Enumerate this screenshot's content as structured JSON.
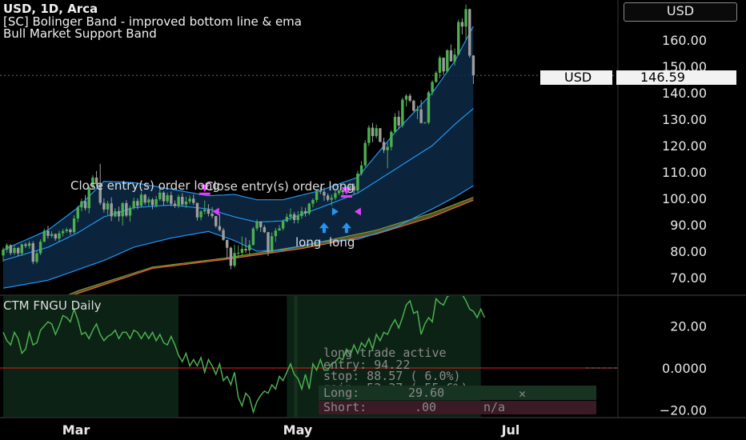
{
  "header": {
    "symbol_line": "USD, 1D, Arca",
    "indicator_line1": "[SC] Bolinger Band - improved bottom line & ema",
    "indicator_line2": "Bull Market Support Band"
  },
  "currency_button": "USD",
  "price_tag": {
    "label": "USD",
    "value": "146.59"
  },
  "lower_pane": {
    "title": "CTM FNGU Daily",
    "info_lines": [
      "long trade active",
      "entry:  94.22",
      "stop:  88.57 ( 6.0%)",
      "gain:  52.37 ( 55.6%)"
    ],
    "long_row": {
      "label": "Long:",
      "value": "29.60",
      "mark": "✕"
    },
    "short_row": {
      "label": "Short:",
      "value": ".00",
      "mark": "n/a"
    }
  },
  "annotations": {
    "close_entry_1": "Close entry(s) order long",
    "close_entry_2": "Close entry(s) order long",
    "long_1": "long",
    "long_2": "long"
  },
  "colors": {
    "up": "#4caf50",
    "down": "#9e9e9e",
    "band_line": "#2196f3",
    "band_fill": "#0d2a45",
    "ema_fill": "#5d6b2c",
    "ema_line": "#e8623a",
    "osc_line": "#4caf50",
    "zero_line": "#b71c1c",
    "sell_marker": "#e040fb",
    "buy_marker": "#2196f3"
  },
  "chart_data": [
    {
      "type": "candlestick",
      "title": "USD, 1D, Arca",
      "x_ticks": [
        "Mar",
        "May",
        "Jul"
      ],
      "y_ticks": [
        70,
        80,
        90,
        100,
        110,
        120,
        130,
        140,
        150,
        160
      ],
      "ylim": [
        63,
        175
      ],
      "last_price": 146.59,
      "candles": [
        [
          78.4,
          81.4,
          76.0,
          80.6
        ],
        [
          80.6,
          83.0,
          79.5,
          82.3
        ],
        [
          82.3,
          82.6,
          78.5,
          79.3
        ],
        [
          79.3,
          82.6,
          78.6,
          81.2
        ],
        [
          81.2,
          81.6,
          78.0,
          79.2
        ],
        [
          79.2,
          82.9,
          78.2,
          82.6
        ],
        [
          82.6,
          83.3,
          81.2,
          82.0
        ],
        [
          82.0,
          83.9,
          80.9,
          83.0
        ],
        [
          83.0,
          83.8,
          75.1,
          76.0
        ],
        [
          76.0,
          80.1,
          75.3,
          79.2
        ],
        [
          79.2,
          84.5,
          78.5,
          83.6
        ],
        [
          83.6,
          88.6,
          83.4,
          87.7
        ],
        [
          87.7,
          89.6,
          84.8,
          85.8
        ],
        [
          85.8,
          87.6,
          85.1,
          86.5
        ],
        [
          86.5,
          86.7,
          84.0,
          84.8
        ],
        [
          84.8,
          87.8,
          83.7,
          86.8
        ],
        [
          86.8,
          88.5,
          85.6,
          87.6
        ],
        [
          87.6,
          88.9,
          86.9,
          88.2
        ],
        [
          88.2,
          88.7,
          86.1,
          87.2
        ],
        [
          87.2,
          93.6,
          86.6,
          92.4
        ],
        [
          92.4,
          97.2,
          91.0,
          96.6
        ],
        [
          96.6,
          99.9,
          95.1,
          98.9
        ],
        [
          98.9,
          101.3,
          95.4,
          96.3
        ],
        [
          96.3,
          104.9,
          94.3,
          104.2
        ],
        [
          104.2,
          108.8,
          103.8,
          107.9
        ],
        [
          107.9,
          110.4,
          104.9,
          105.4
        ],
        [
          105.4,
          113.1,
          97.5,
          98.3
        ],
        [
          98.3,
          100.0,
          94.6,
          95.8
        ],
        [
          95.8,
          99.1,
          93.8,
          98.1
        ],
        [
          98.1,
          100.4,
          91.4,
          93.2
        ],
        [
          93.2,
          96.3,
          92.8,
          95.2
        ],
        [
          95.2,
          96.9,
          91.3,
          93.2
        ],
        [
          93.2,
          98.6,
          89.7,
          98.2
        ],
        [
          98.2,
          99.3,
          92.9,
          93.5
        ],
        [
          93.5,
          97.2,
          91.2,
          96.4
        ],
        [
          96.4,
          100.3,
          95.7,
          99.0
        ],
        [
          99.0,
          100.0,
          95.9,
          97.2
        ],
        [
          97.2,
          102.3,
          96.6,
          101.4
        ],
        [
          101.4,
          101.7,
          97.5,
          98.4
        ],
        [
          98.4,
          100.6,
          97.0,
          99.6
        ],
        [
          99.6,
          100.2,
          95.9,
          97.4
        ],
        [
          97.4,
          100.9,
          96.6,
          99.7
        ],
        [
          99.7,
          104.1,
          99.0,
          102.2
        ],
        [
          102.2,
          102.7,
          97.2,
          98.9
        ],
        [
          98.9,
          102.2,
          98.1,
          101.2
        ],
        [
          101.2,
          102.6,
          97.0,
          98.0
        ],
        [
          98.0,
          99.2,
          96.4,
          97.2
        ],
        [
          97.2,
          101.5,
          96.3,
          100.6
        ],
        [
          100.6,
          102.0,
          96.9,
          97.7
        ],
        [
          97.7,
          100.7,
          96.4,
          98.8
        ],
        [
          98.8,
          101.1,
          97.9,
          99.9
        ],
        [
          99.9,
          101.5,
          97.5,
          98.3
        ],
        [
          98.3,
          98.3,
          91.6,
          92.8
        ],
        [
          92.8,
          95.6,
          91.7,
          95.1
        ],
        [
          95.1,
          99.2,
          94.0,
          95.8
        ],
        [
          95.8,
          97.8,
          93.2,
          94.2
        ],
        [
          94.2,
          96.7,
          92.5,
          93.3
        ],
        [
          93.3,
          93.3,
          88.9,
          89.5
        ],
        [
          89.5,
          94.1,
          87.5,
          88.0
        ],
        [
          88.0,
          88.8,
          84.0,
          84.3
        ],
        [
          84.3,
          84.3,
          77.0,
          81.3
        ],
        [
          81.3,
          81.7,
          73.2,
          74.5
        ],
        [
          74.5,
          82.4,
          73.8,
          79.3
        ],
        [
          79.3,
          82.2,
          77.6,
          79.4
        ],
        [
          79.4,
          85.6,
          78.4,
          80.9
        ],
        [
          80.9,
          85.2,
          79.3,
          80.3
        ],
        [
          80.3,
          84.2,
          78.2,
          82.4
        ],
        [
          82.4,
          89.2,
          82.1,
          88.6
        ],
        [
          88.6,
          92.0,
          87.7,
          91.3
        ],
        [
          91.3,
          91.3,
          87.3,
          89.1
        ],
        [
          89.1,
          89.9,
          86.9,
          87.2
        ],
        [
          87.2,
          87.2,
          78.2,
          79.6
        ],
        [
          79.6,
          87.1,
          79.5,
          85.7
        ],
        [
          85.7,
          88.8,
          83.5,
          87.8
        ],
        [
          87.8,
          89.9,
          88.1,
          88.6
        ],
        [
          88.6,
          92.1,
          87.8,
          91.3
        ],
        [
          91.3,
          94.2,
          90.9,
          93.0
        ],
        [
          93.0,
          96.2,
          91.6,
          94.0
        ],
        [
          94.0,
          94.9,
          90.5,
          91.8
        ],
        [
          91.8,
          95.2,
          90.5,
          93.3
        ],
        [
          93.3,
          96.8,
          92.3,
          95.2
        ],
        [
          95.2,
          96.5,
          93.1,
          94.3
        ],
        [
          94.3,
          98.4,
          93.6,
          98.0
        ],
        [
          98.0,
          100.0,
          96.6,
          99.4
        ],
        [
          99.4,
          103.2,
          98.5,
          102.8
        ],
        [
          102.8,
          104.3,
          101.6,
          102.5
        ],
        [
          102.5,
          104.1,
          99.1,
          101.1
        ],
        [
          101.1,
          101.9,
          98.8,
          99.5
        ],
        [
          99.5,
          101.5,
          97.2,
          100.2
        ],
        [
          100.2,
          102.9,
          99.4,
          102.0
        ],
        [
          102.0,
          103.5,
          101.2,
          103.0
        ],
        [
          103.0,
          104.3,
          101.3,
          102.4
        ],
        [
          102.4,
          104.9,
          101.9,
          103.9
        ],
        [
          103.9,
          105.4,
          103.0,
          104.6
        ],
        [
          104.6,
          105.6,
          101.6,
          103.0
        ],
        [
          103.0,
          110.5,
          102.3,
          109.4
        ],
        [
          109.4,
          114.1,
          108.6,
          112.5
        ],
        [
          112.5,
          122.0,
          111.8,
          121.0
        ],
        [
          121.0,
          127.7,
          119.8,
          126.8
        ],
        [
          126.8,
          128.6,
          121.3,
          123.6
        ],
        [
          123.6,
          128.0,
          122.8,
          126.6
        ],
        [
          126.6,
          126.6,
          121.2,
          121.4
        ],
        [
          121.4,
          123.0,
          117.2,
          118.3
        ],
        [
          118.3,
          121.2,
          111.4,
          119.5
        ],
        [
          119.5,
          125.8,
          118.2,
          125.2
        ],
        [
          125.2,
          132.3,
          124.7,
          130.9
        ],
        [
          130.9,
          133.2,
          126.3,
          127.6
        ],
        [
          127.6,
          138.2,
          126.8,
          137.4
        ],
        [
          137.4,
          139.5,
          134.8,
          138.9
        ],
        [
          138.9,
          139.7,
          136.4,
          137.0
        ],
        [
          137.0,
          137.4,
          132.9,
          133.2
        ],
        [
          133.2,
          135.2,
          130.0,
          133.7
        ],
        [
          133.7,
          137.2,
          128.3,
          128.6
        ],
        [
          128.6,
          129.0,
          128.4,
          128.7
        ],
        [
          128.7,
          140.8,
          128.1,
          140.2
        ],
        [
          140.2,
          144.7,
          139.2,
          144.1
        ],
        [
          144.1,
          148.2,
          143.8,
          147.6
        ],
        [
          147.6,
          154.1,
          145.5,
          153.3
        ],
        [
          153.3,
          153.4,
          146.7,
          148.1
        ],
        [
          148.1,
          156.5,
          147.7,
          156.1
        ],
        [
          156.1,
          158.3,
          151.8,
          151.9
        ],
        [
          151.9,
          156.8,
          150.3,
          154.5
        ],
        [
          154.5,
          167.7,
          154.2,
          166.8
        ],
        [
          166.8,
          168.2,
          162.1,
          165.1
        ],
        [
          165.1,
          173.4,
          160.1,
          171.7
        ],
        [
          171.7,
          171.9,
          153.3,
          154.1
        ],
        [
          154.1,
          154.3,
          143.4,
          146.6
        ]
      ],
      "bollinger_upper": [
        [
          0,
          80.5
        ],
        [
          12,
          88.0
        ],
        [
          20,
          96.5
        ],
        [
          27,
          106.5
        ],
        [
          35,
          106.0
        ],
        [
          45,
          103.5
        ],
        [
          55,
          101.0
        ],
        [
          62,
          101.5
        ],
        [
          68,
          99.5
        ],
        [
          75,
          99.5
        ],
        [
          85,
          103.0
        ],
        [
          95,
          108.0
        ],
        [
          105,
          125.0
        ],
        [
          115,
          140.0
        ],
        [
          121,
          152.0
        ],
        [
          128,
          170.5
        ]
      ],
      "bollinger_basis": [
        [
          0,
          76.5
        ],
        [
          12,
          81.5
        ],
        [
          20,
          87.0
        ],
        [
          27,
          93.0
        ],
        [
          35,
          96.5
        ],
        [
          45,
          97.5
        ],
        [
          55,
          96.0
        ],
        [
          62,
          93.0
        ],
        [
          68,
          91.0
        ],
        [
          75,
          91.5
        ],
        [
          85,
          96.5
        ],
        [
          95,
          102.0
        ],
        [
          105,
          111.0
        ],
        [
          115,
          120.0
        ],
        [
          121,
          128.0
        ],
        [
          128,
          136.5
        ]
      ],
      "bollinger_lower": [
        [
          0,
          66.0
        ],
        [
          12,
          69.0
        ],
        [
          20,
          73.0
        ],
        [
          27,
          76.5
        ],
        [
          35,
          81.5
        ],
        [
          45,
          85.0
        ],
        [
          55,
          87.5
        ],
        [
          62,
          84.0
        ],
        [
          68,
          80.0
        ],
        [
          75,
          80.5
        ],
        [
          85,
          83.5
        ],
        [
          95,
          84.5
        ],
        [
          105,
          89.0
        ],
        [
          115,
          96.0
        ],
        [
          121,
          100.5
        ],
        [
          128,
          106.5
        ]
      ],
      "ema_support_top": [
        [
          0,
          53.0
        ],
        [
          20,
          65.0
        ],
        [
          40,
          74.0
        ],
        [
          60,
          77.5
        ],
        [
          80,
          82.0
        ],
        [
          100,
          88.0
        ],
        [
          115,
          94.5
        ],
        [
          128,
          101.5
        ]
      ],
      "ema_support_bottom": [
        [
          0,
          52.0
        ],
        [
          20,
          64.0
        ],
        [
          40,
          73.5
        ],
        [
          60,
          77.0
        ],
        [
          80,
          81.0
        ],
        [
          100,
          86.5
        ],
        [
          115,
          93.0
        ],
        [
          128,
          100.5
        ]
      ],
      "signals": [
        {
          "index": 54,
          "kind": "sell",
          "price": 101
        },
        {
          "index": 57,
          "kind": "sell_small",
          "price": 95
        },
        {
          "index": 92,
          "kind": "sell",
          "price": 100
        },
        {
          "index": 95,
          "kind": "sell_small",
          "price": 95
        },
        {
          "index": 86,
          "kind": "buy",
          "price": 89
        },
        {
          "index": 92,
          "kind": "buy",
          "price": 89
        },
        {
          "index": 89,
          "kind": "buy_small",
          "price": 95
        }
      ]
    },
    {
      "type": "line",
      "title": "CTM FNGU Daily",
      "y_ticks": [
        20.0,
        0.0,
        -20.0
      ],
      "ylim": [
        -26,
        34
      ],
      "values": [
        17,
        13,
        11,
        17,
        14,
        7,
        9,
        17,
        11,
        12,
        18,
        20,
        22,
        21,
        16,
        20,
        25,
        24,
        22,
        28,
        23,
        16,
        17,
        14,
        18,
        21,
        16,
        13,
        15,
        16,
        18,
        14,
        17,
        17,
        14,
        18,
        17,
        14,
        17,
        14,
        17,
        13,
        16,
        12,
        11,
        15,
        11,
        6,
        3,
        7,
        1,
        4,
        1,
        5,
        -2,
        4,
        1,
        -3,
        2,
        -6,
        -4,
        -8,
        -2,
        -14,
        -18,
        -12,
        -14,
        -21,
        -16,
        -13,
        -11,
        -12,
        -8,
        -10,
        -4,
        -6,
        -2,
        2,
        -3,
        -5,
        -10,
        -3,
        -10,
        2,
        -1,
        4,
        -1,
        -1,
        2,
        3,
        5,
        4,
        9,
        6,
        11,
        7,
        12,
        10,
        14,
        9,
        16,
        13,
        17,
        16,
        20,
        23,
        19,
        24,
        30,
        32,
        26,
        27,
        16,
        21,
        24,
        22,
        33,
        31,
        30,
        34,
        35,
        36,
        37,
        35,
        32,
        28,
        27,
        24,
        28,
        24
      ]
    }
  ]
}
